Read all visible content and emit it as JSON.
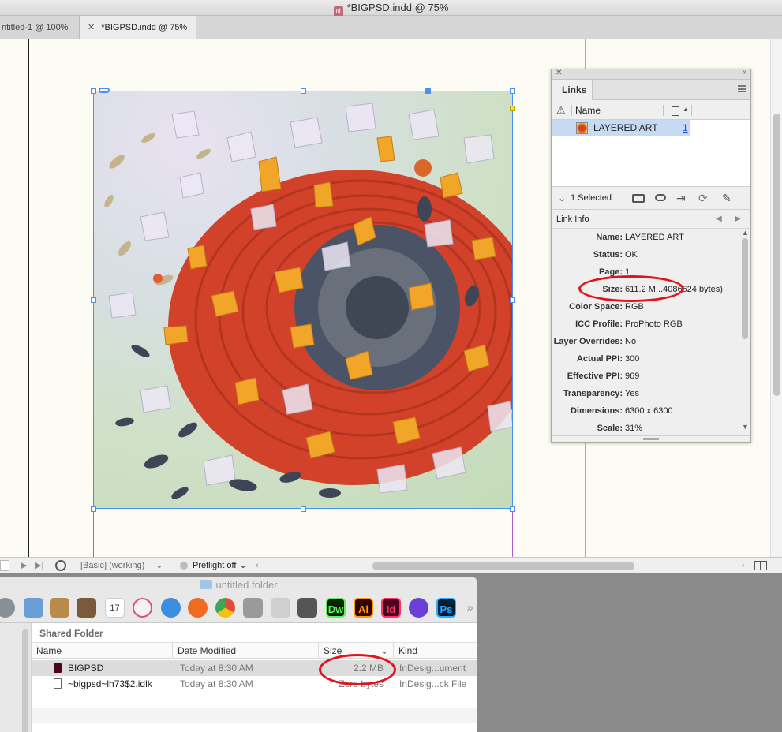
{
  "indesign": {
    "window_title": "*BIGPSD.indd @ 75%",
    "tabs": [
      {
        "label": "ntitled-1 @ 100%"
      },
      {
        "label": "*BIGPSD.indd @ 75%",
        "close": "✕"
      }
    ],
    "status_bar": {
      "page_field": "",
      "workspace": "[Basic] (working)",
      "preflight": "Preflight off"
    }
  },
  "links_panel": {
    "tab": "Links",
    "column_name": "Name",
    "link_item": {
      "name": "LAYERED ART",
      "page": "1"
    },
    "selected_text": "1 Selected",
    "link_info_title": "Link Info",
    "info": [
      {
        "label": "Name:",
        "value": "LAYERED ART"
      },
      {
        "label": "Status:",
        "value": "OK"
      },
      {
        "label": "Page:",
        "value": "1"
      },
      {
        "label": "Size:",
        "value": "611.2 M...4086524 bytes)"
      },
      {
        "label": "Color Space:",
        "value": "RGB"
      },
      {
        "label": "ICC Profile:",
        "value": "ProPhoto RGB"
      },
      {
        "label": "Layer Overrides:",
        "value": "No"
      },
      {
        "label": "Actual PPI:",
        "value": "300"
      },
      {
        "label": "Effective PPI:",
        "value": "969"
      },
      {
        "label": "Transparency:",
        "value": "Yes"
      },
      {
        "label": "Dimensions:",
        "value": "6300 x 6300"
      },
      {
        "label": "Scale:",
        "value": "31%"
      }
    ]
  },
  "finder": {
    "title": "untitled folder",
    "dock_apps": [
      {
        "icon": "system-preferences-icon",
        "label": ""
      },
      {
        "icon": "preview-icon",
        "label": ""
      },
      {
        "icon": "script-editor-icon",
        "label": ""
      },
      {
        "icon": "automator-icon",
        "label": ""
      },
      {
        "icon": "calendar-icon",
        "label": "17"
      },
      {
        "icon": "itunes-icon",
        "label": ""
      },
      {
        "icon": "safari-icon",
        "label": ""
      },
      {
        "icon": "firefox-icon",
        "label": ""
      },
      {
        "icon": "chrome-icon",
        "label": ""
      },
      {
        "icon": "screenshot-icon",
        "label": ""
      },
      {
        "icon": "scanner-icon",
        "label": ""
      },
      {
        "icon": "printer-icon",
        "label": ""
      },
      {
        "icon": "dreamweaver-icon",
        "label": "Dw"
      },
      {
        "icon": "illustrator-icon",
        "label": "Ai"
      },
      {
        "icon": "indesign-icon",
        "label": "Id"
      },
      {
        "icon": "premiere-rush-icon",
        "label": ""
      },
      {
        "icon": "photoshop-icon",
        "label": "Ps"
      }
    ],
    "dock_overflow": "»",
    "section_title": "Shared Folder",
    "columns": {
      "name": "Name",
      "date": "Date Modified",
      "size": "Size",
      "kind": "Kind"
    },
    "rows": [
      {
        "name": "BIGPSD",
        "date": "Today at 8:30 AM",
        "size": "2.2 MB",
        "kind": "InDesig...ument"
      },
      {
        "name": "~bigpsd~lh73$2.idlk",
        "date": "Today at 8:30 AM",
        "size": "Zero bytes",
        "kind": "InDesig...ck File"
      }
    ]
  },
  "colors": {
    "selection_blue": "#4b8ff0",
    "annotation_red": "#e0141c",
    "artwork_red": "#d2422a",
    "artwork_orange": "#f1a529"
  }
}
